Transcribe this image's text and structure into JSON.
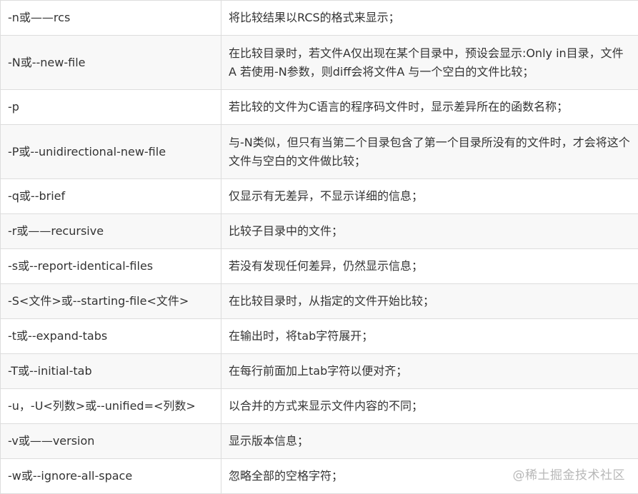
{
  "rows": [
    {
      "option": "-n或——rcs",
      "description": "将比较结果以RCS的格式来显示；"
    },
    {
      "option": "-N或--new-file",
      "description": "在比较目录时，若文件A仅出现在某个目录中，预设会显示:Only in目录，文件A 若使用-N参数，则diff会将文件A 与一个空白的文件比较；"
    },
    {
      "option": "-p",
      "description": "若比较的文件为C语言的程序码文件时，显示差异所在的函数名称；"
    },
    {
      "option": "-P或--unidirectional-new-file",
      "description": "与-N类似，但只有当第二个目录包含了第一个目录所没有的文件时，才会将这个文件与空白的文件做比较；"
    },
    {
      "option": "-q或--brief",
      "description": "仅显示有无差异，不显示详细的信息；"
    },
    {
      "option": "-r或——recursive",
      "description": "比较子目录中的文件；"
    },
    {
      "option": "-s或--report-identical-files",
      "description": "若没有发现任何差异，仍然显示信息；"
    },
    {
      "option": "-S<文件>或--starting-file<文件>",
      "description": "在比较目录时，从指定的文件开始比较；"
    },
    {
      "option": "-t或--expand-tabs",
      "description": "在输出时，将tab字符展开；"
    },
    {
      "option": "-T或--initial-tab",
      "description": "在每行前面加上tab字符以便对齐；"
    },
    {
      "option": "-u，-U<列数>或--unified=<列数>",
      "description": "以合并的方式来显示文件内容的不同；"
    },
    {
      "option": "-v或——version",
      "description": "显示版本信息；"
    },
    {
      "option": "-w或--ignore-all-space",
      "description": "忽略全部的空格字符；"
    }
  ],
  "watermark": "@稀土掘金技术社区"
}
